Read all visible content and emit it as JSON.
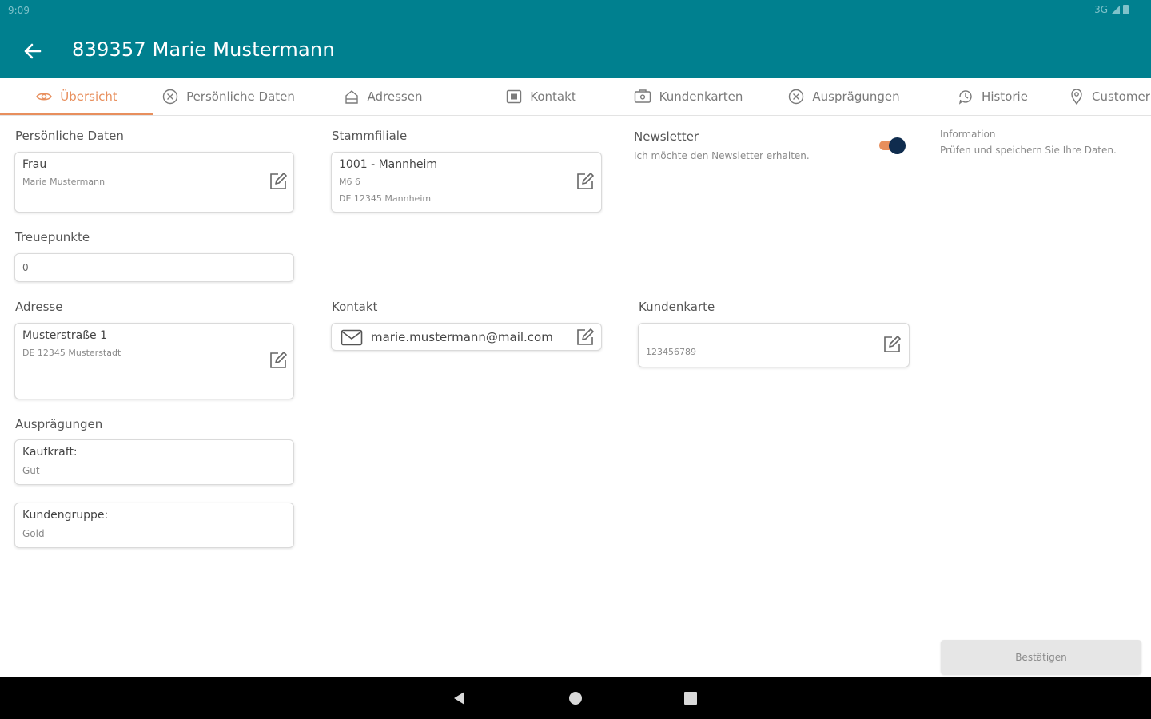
{
  "status_bar": {
    "time": "9:09",
    "network": "3G"
  },
  "app_bar": {
    "title": "839357 Marie Mustermann"
  },
  "tabs": [
    {
      "label": "Übersicht",
      "icon": "eye-icon",
      "active": true
    },
    {
      "label": "Persönliche Daten",
      "icon": "person-circle-icon"
    },
    {
      "label": "Adressen",
      "icon": "home-icon"
    },
    {
      "label": "Kontakt",
      "icon": "contact-card-icon"
    },
    {
      "label": "Kundenkarten",
      "icon": "card-icon"
    },
    {
      "label": "Ausprägungen",
      "icon": "settings-circle-icon"
    },
    {
      "label": "Historie",
      "icon": "history-icon"
    },
    {
      "label": "Customer",
      "icon": "location-pin-icon"
    }
  ],
  "personal": {
    "label": "Persönliche Daten",
    "salutation": "Frau",
    "name": "Marie Mustermann"
  },
  "home_branch": {
    "label": "Stammfiliale",
    "name": "1001 - Mannheim",
    "street": "M6 6",
    "city": "DE 12345 Mannheim"
  },
  "newsletter": {
    "label": "Newsletter",
    "description": "Ich möchte den Newsletter erhalten.",
    "enabled": true
  },
  "information": {
    "title": "Information",
    "text": "Prüfen und speichern Sie Ihre Daten."
  },
  "loyalty": {
    "label": "Treuepunkte",
    "value": "0"
  },
  "address": {
    "label": "Adresse",
    "street": "Musterstraße 1",
    "city": "DE 12345 Musterstadt"
  },
  "contact": {
    "label": "Kontakt",
    "email": "marie.mustermann@mail.com"
  },
  "customer_card": {
    "label": "Kundenkarte",
    "number": "123456789"
  },
  "characteristics": {
    "label": "Ausprägungen",
    "items": [
      {
        "key": "Kaufkraft:",
        "value": "Gut"
      },
      {
        "key": "Kundengruppe:",
        "value": "Gold"
      }
    ]
  },
  "confirm_button": {
    "label": "Bestätigen"
  },
  "colors": {
    "primary": "#00808f",
    "accent": "#e88f5d",
    "toggle_thumb": "#0f2c4e"
  }
}
